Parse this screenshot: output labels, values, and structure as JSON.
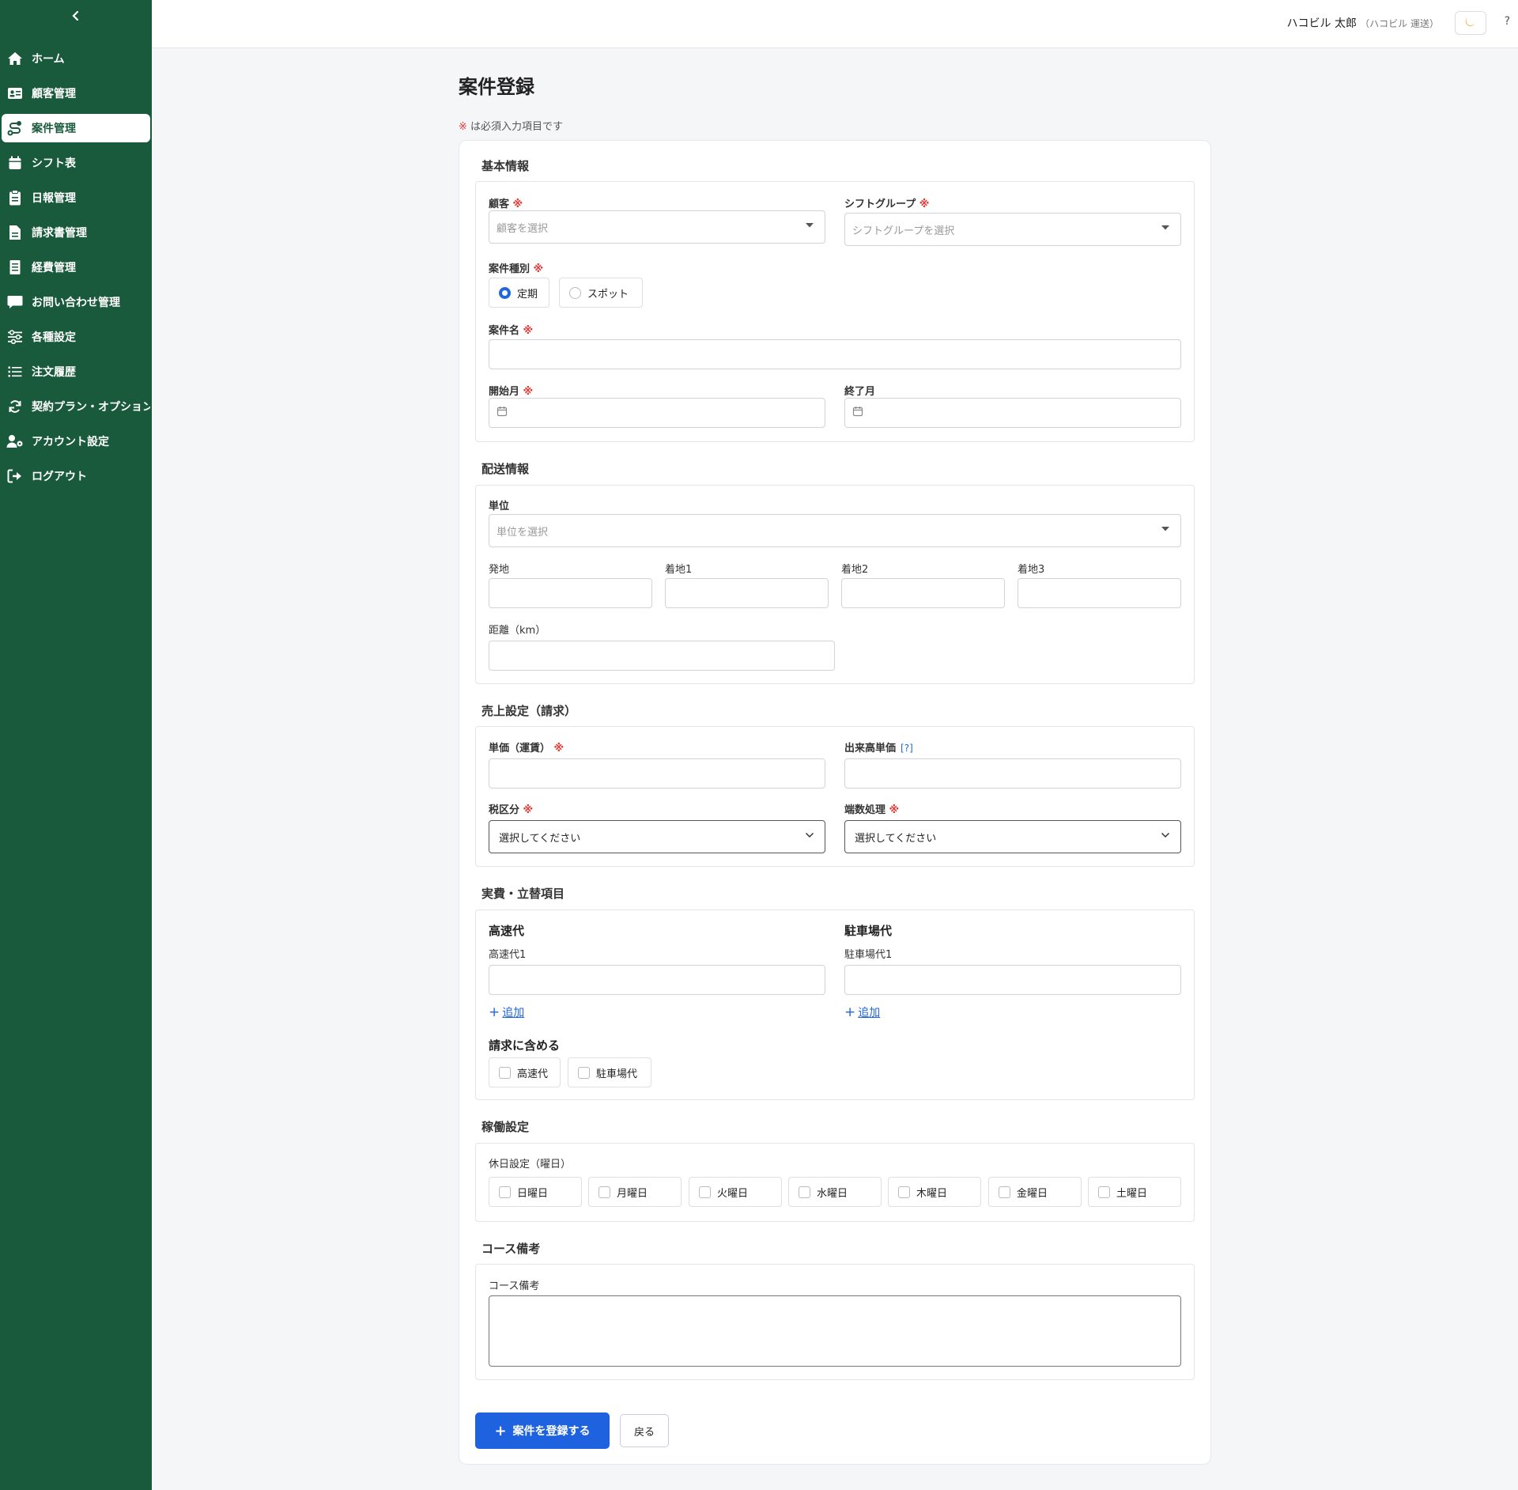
{
  "sidebar": {
    "items": [
      {
        "label": "ホーム"
      },
      {
        "label": "顧客管理"
      },
      {
        "label": "案件管理"
      },
      {
        "label": "シフト表"
      },
      {
        "label": "日報管理"
      },
      {
        "label": "請求書管理"
      },
      {
        "label": "経費管理"
      },
      {
        "label": "お問い合わせ管理"
      },
      {
        "label": "各種設定"
      },
      {
        "label": "注文履歴"
      },
      {
        "label": "契約プラン・オプション"
      },
      {
        "label": "アカウント設定"
      },
      {
        "label": "ログアウト"
      }
    ]
  },
  "header": {
    "user_name": "ハコビル 太郎",
    "company": "（ハコビル 運送）",
    "help": "?"
  },
  "page": {
    "title": "案件登録",
    "required_mark": "※",
    "required_note": "は必須入力項目です"
  },
  "basic": {
    "title": "基本情報",
    "customer_label": "顧客",
    "customer_placeholder": "顧客を選択",
    "shift_group_label": "シフトグループ",
    "shift_group_placeholder": "シフトグループを選択",
    "type_label": "案件種別",
    "type_options": [
      "定期",
      "スポット"
    ],
    "name_label": "案件名",
    "start_label": "開始月",
    "end_label": "終了月"
  },
  "delivery": {
    "title": "配送情報",
    "unit_label": "単位",
    "unit_placeholder": "単位を選択",
    "origin_label": "発地",
    "dest1_label": "着地1",
    "dest2_label": "着地2",
    "dest3_label": "着地3",
    "distance_label": "距離（km）"
  },
  "sales": {
    "title": "売上設定（請求）",
    "unit_price_label": "単価（運賃）",
    "piece_price_label": "出来高単価",
    "help_link": "[?]",
    "tax_label": "税区分",
    "tax_value": "選択してください",
    "rounding_label": "端数処理",
    "rounding_value": "選択してください"
  },
  "expenses": {
    "title": "実費・立替項目",
    "highway_title": "高速代",
    "highway_field_label": "高速代1",
    "parking_title": "駐車場代",
    "parking_field_label": "駐車場代1",
    "add_label": "追加",
    "include_title": "請求に含める",
    "include_options": [
      "高速代",
      "駐車場代"
    ]
  },
  "operation": {
    "title": "稼働設定",
    "holiday_label": "休日設定（曜日）",
    "days": [
      "日曜日",
      "月曜日",
      "火曜日",
      "水曜日",
      "木曜日",
      "金曜日",
      "土曜日"
    ]
  },
  "notes": {
    "title": "コース備考",
    "field_label": "コース備考"
  },
  "actions": {
    "submit_label": "案件を登録する",
    "back_label": "戻る"
  },
  "colors": {
    "sidebar": "#195a3c",
    "primary": "#1f62e0",
    "required": "#e53935"
  }
}
